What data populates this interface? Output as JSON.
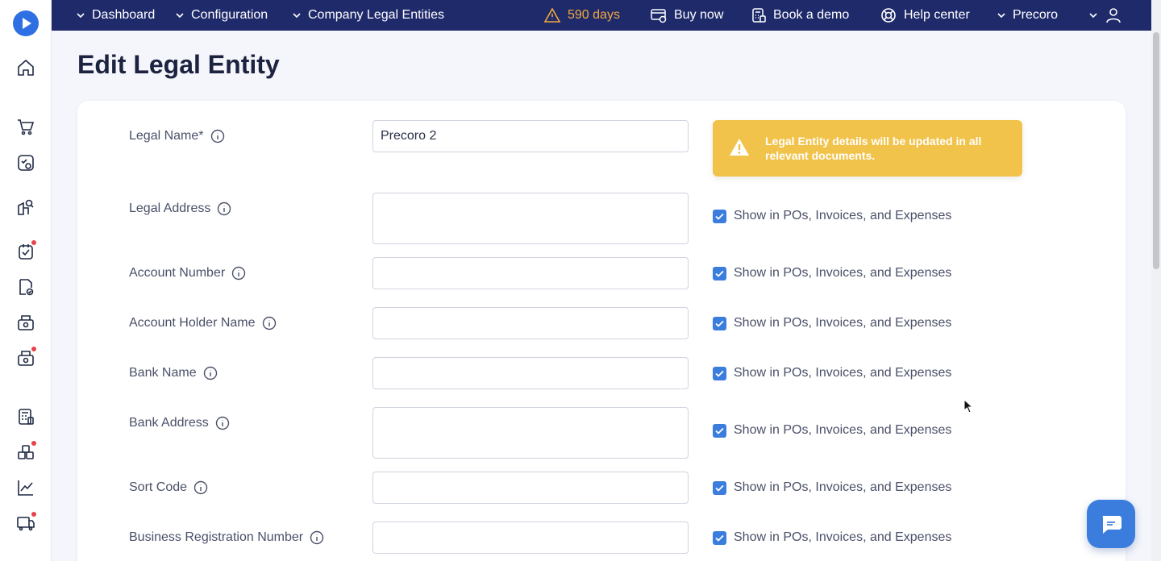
{
  "topbar": {
    "dashboard": "Dashboard",
    "configuration": "Configuration",
    "legal_entities": "Company Legal Entities",
    "days": "590 days",
    "buy_now": "Buy now",
    "book_demo": "Book a demo",
    "help_center": "Help center",
    "company": "Precoro"
  },
  "page": {
    "title": "Edit Legal Entity"
  },
  "alert": {
    "text": "Legal Entity details will be updated in all relevant documents."
  },
  "form": {
    "show_label": "Show in POs, Invoices, and Expenses",
    "fields": [
      {
        "label": "Legal Name*",
        "value": "Precoro 2"
      },
      {
        "label": "Legal Address",
        "value": ""
      },
      {
        "label": "Account Number",
        "value": ""
      },
      {
        "label": "Account Holder Name",
        "value": ""
      },
      {
        "label": "Bank Name",
        "value": ""
      },
      {
        "label": "Bank Address",
        "value": ""
      },
      {
        "label": "Sort Code",
        "value": ""
      },
      {
        "label": "Business Registration Number",
        "value": ""
      }
    ]
  },
  "colors": {
    "topbar": "#1f2a6b",
    "accent": "#3b7ddd",
    "warning": "#f2c34b",
    "days": "#f2a93b"
  }
}
